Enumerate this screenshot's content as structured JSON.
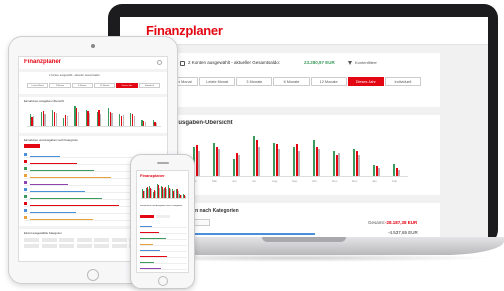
{
  "app": {
    "title": "Finanzplaner",
    "brand_color": "#e30613",
    "help_label": "?"
  },
  "laptop": {
    "accounts_text": "2 Konten ausgewählt - aktueller Gesamtsaldo:",
    "balance": "23.280,97 EUR",
    "filter_label": "Kontenfiltern",
    "periods": [
      "Letzter Monat",
      "Letzte Monat",
      "3 Monate",
      "6 Monate",
      "12 Monate",
      "Dieses Jahr",
      "Individuell"
    ],
    "selected_period_index": 5,
    "income_section_title": "Ausgaben-Übersicht",
    "months": [
      "Mrz",
      "Apr",
      "Mai",
      "Jun",
      "Jul",
      "Aug",
      "Sep",
      "Okt",
      "Nov",
      "Dez",
      "Jan",
      "Feb"
    ],
    "income_colors": {
      "income": "#3a9a5b",
      "expense": "#e30613",
      "neutral": "#b8b8b8"
    },
    "category_section_title": "Ausgaben nach Kategorien",
    "total_label": "Gesamt:",
    "total_value": "-28.187,38 EUR",
    "category_value": "-4.537,65 EUR"
  },
  "chart_data": [
    {
      "type": "bar",
      "title": "Ausgaben-Übersicht",
      "categories": [
        "Mrz",
        "Apr",
        "Mai",
        "Jun",
        "Jul",
        "Aug",
        "Sep",
        "Okt",
        "Nov",
        "Dez",
        "Jan",
        "Feb"
      ],
      "series": [
        {
          "values": [
            26,
            30,
            35,
            18,
            42,
            35,
            30,
            38,
            26,
            28,
            12,
            13
          ]
        },
        {
          "values": [
            20,
            32,
            30,
            24,
            38,
            33,
            34,
            30,
            22,
            26,
            10,
            8
          ]
        },
        {
          "values": [
            22,
            26,
            28,
            22,
            30,
            28,
            26,
            28,
            24,
            22,
            8,
            6
          ]
        }
      ]
    }
  ],
  "tablet": {
    "header_text": "2 Konten ausgewählt - aktueller Gesamtsaldo:",
    "periods": [
      "Letzter Monat",
      "3 Monate",
      "6 Monate",
      "12 Monate",
      "Dieses Jahr",
      "Individuell"
    ],
    "selected_period_index": 4,
    "chart_title": "Einnahmen-Ausgaben-Übersicht",
    "category_title": "Einnahmen und Ausgaben nach Kategorien",
    "bottom_title": "Einzel ausgewählte Kategorien"
  },
  "phone": {
    "title": "Finanzplaner",
    "category_title": "Einnahmen und Ausgaben nach Kategorien"
  }
}
